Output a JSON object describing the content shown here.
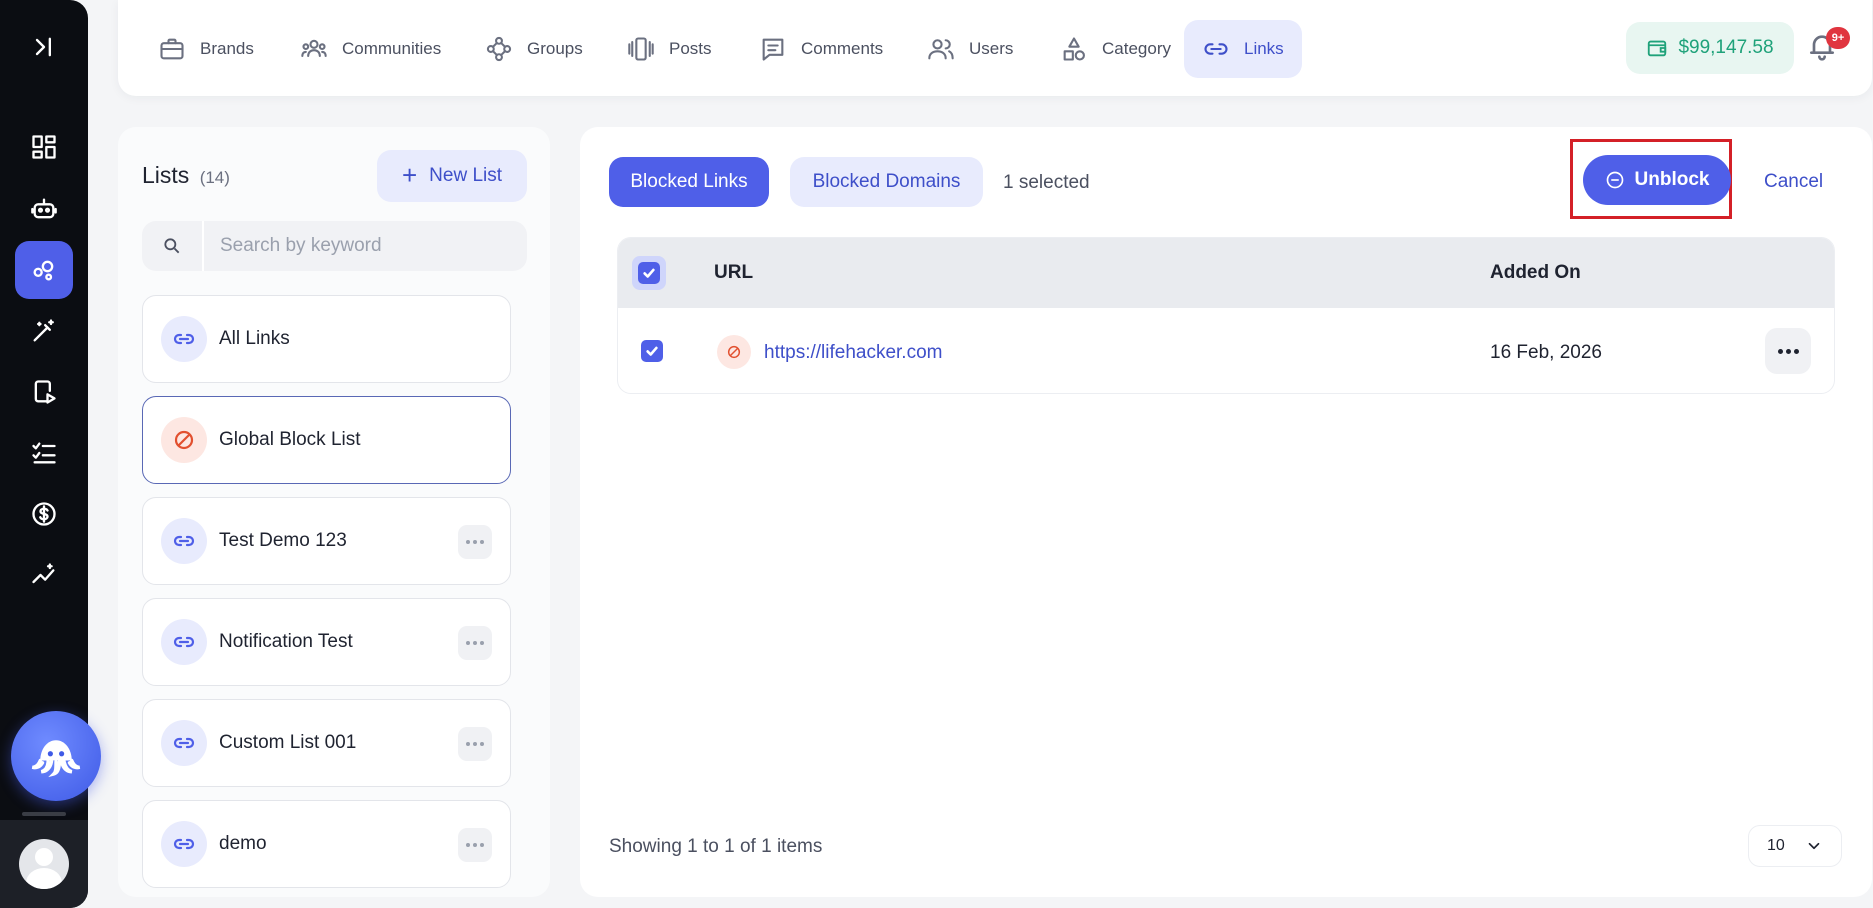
{
  "nav": {
    "items": [
      {
        "label": "Brands",
        "icon": "briefcase-icon"
      },
      {
        "label": "Communities",
        "icon": "people-group-icon"
      },
      {
        "label": "Groups",
        "icon": "nodes-icon"
      },
      {
        "label": "Posts",
        "icon": "carousel-icon"
      },
      {
        "label": "Comments",
        "icon": "comment-icon"
      },
      {
        "label": "Users",
        "icon": "users-icon"
      },
      {
        "label": "Category",
        "icon": "shapes-icon"
      },
      {
        "label": "Links",
        "icon": "link-icon",
        "active": true
      }
    ],
    "wallet": "$99,147.58",
    "notification_badge": "9+"
  },
  "sidebar_icons": [
    "expand-icon",
    "dashboard-icon",
    "robot-icon",
    "circles-icon",
    "magic-wand-icon",
    "device-play-icon",
    "checklist-icon",
    "dollar-icon",
    "trend-icon"
  ],
  "lists": {
    "title": "Lists",
    "count": "(14)",
    "new_list_label": "New List",
    "search_placeholder": "Search by keyword",
    "items": [
      {
        "label": "All Links",
        "icon": "link-icon"
      },
      {
        "label": "Global Block List",
        "icon": "block-icon",
        "selected": true
      },
      {
        "label": "Test Demo 123",
        "icon": "link-icon"
      },
      {
        "label": "Notification Test",
        "icon": "link-icon"
      },
      {
        "label": "Custom List 001",
        "icon": "link-icon"
      },
      {
        "label": "demo",
        "icon": "link-icon"
      }
    ]
  },
  "main": {
    "tab_active": "Blocked Links",
    "tab_inactive": "Blocked Domains",
    "selected_text": "1 selected",
    "unblock_label": "Unblock",
    "cancel_label": "Cancel",
    "table": {
      "col_url": "URL",
      "col_added": "Added On",
      "rows": [
        {
          "url": "https://lifehacker.com",
          "added_on": "16 Feb, 2026",
          "checked": true
        }
      ]
    },
    "showing": "Showing 1 to 1 of 1 items",
    "page_size": "10"
  },
  "colors": {
    "accent": "#4f5fe8",
    "rail": "#0b0d12",
    "wallet_green": "#1fa27a",
    "block_red": "#e2502f",
    "highlight_red": "#d42027"
  }
}
